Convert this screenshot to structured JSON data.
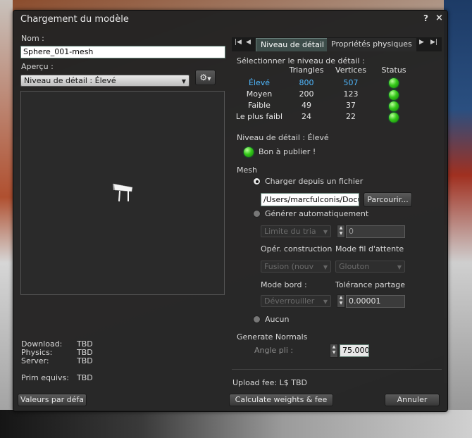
{
  "window": {
    "title": "Chargement du modèle",
    "help_glyph": "?",
    "close_glyph": "×"
  },
  "left": {
    "name_label": "Nom :",
    "name_value": "Sphere_001-mesh",
    "preview_label": "Aperçu :",
    "preview_select": "Niveau de détail : Élevé",
    "gear_glyph": "⚙",
    "stats": [
      {
        "label": "Download:",
        "value": "TBD"
      },
      {
        "label": "Physics:",
        "value": "TBD"
      },
      {
        "label": "Server:",
        "value": "TBD"
      }
    ],
    "prim_label": "Prim equivs:",
    "prim_value": "TBD"
  },
  "tabs": {
    "items": [
      {
        "label": "Niveau de détail"
      },
      {
        "label": "Propriétés physiques"
      }
    ]
  },
  "lod": {
    "select_label": "Sélectionner le niveau de détail :",
    "headers": {
      "triangles": "Triangles",
      "vertices": "Vertices",
      "status": "Status"
    },
    "rows": [
      {
        "name": "Élevé",
        "triangles": "800",
        "vertices": "507"
      },
      {
        "name": "Moyen",
        "triangles": "200",
        "vertices": "123"
      },
      {
        "name": "Faible",
        "triangles": "49",
        "vertices": "37"
      },
      {
        "name": "Le plus faibl",
        "triangles": "24",
        "vertices": "22"
      }
    ],
    "status_color": "#35c91a",
    "highlight_color": "#4fb8ff",
    "lod_label": "Niveau de détail : Élevé",
    "ready_text": "Bon à publier !"
  },
  "mesh": {
    "section_label": "Mesh",
    "load_from_file": "Charger depuis un fichier",
    "file_path": "/Users/marcfulconis/Docu",
    "browse_button": "Parcourir...",
    "generate_auto": "Générer automatiquement",
    "triangle_limit_select": "Limite du tria",
    "triangle_limit_value": "0",
    "build_op_label": "Opér. construction",
    "queue_mode_label": "Mode fil d'attente",
    "build_op_select": "Fusion (nouv",
    "queue_mode_select": "Glouton",
    "border_mode_label": "Mode bord :",
    "share_tolerance_label": "Tolérance partage",
    "border_mode_select": "Déverrouiller",
    "share_tolerance_value": "0.00001",
    "none_option": "Aucun"
  },
  "normals": {
    "section_label": "Generate Normals",
    "crease_angle_label": "Angle pli :",
    "crease_angle_value": "75.000"
  },
  "footer": {
    "upload_fee": "Upload fee: L$ TBD",
    "defaults_button": "Valeurs par défa",
    "calculate_button": "Calculate weights & fee",
    "cancel_button": "Annuler"
  }
}
